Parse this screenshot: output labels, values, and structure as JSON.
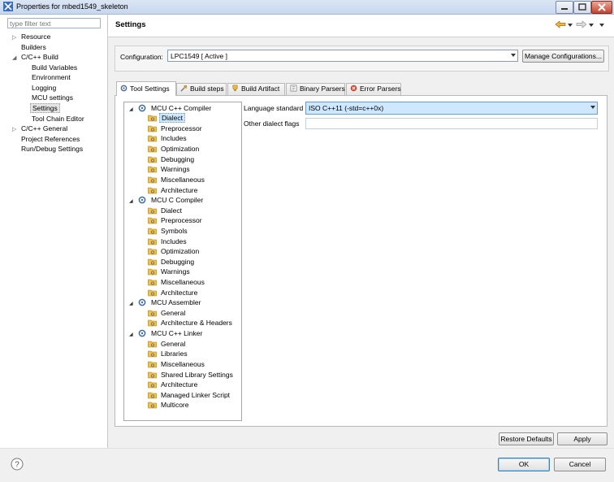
{
  "window": {
    "title": "Properties for mbed1549_skeleton"
  },
  "filter": {
    "placeholder": "type filter text"
  },
  "nav": {
    "items": [
      {
        "label": "Resource",
        "expander": "▷"
      },
      {
        "label": "Builders"
      },
      {
        "label": "C/C++ Build",
        "expander": "◢"
      },
      {
        "label": "Build Variables"
      },
      {
        "label": "Environment"
      },
      {
        "label": "Logging"
      },
      {
        "label": "MCU settings"
      },
      {
        "label": "Settings"
      },
      {
        "label": "Tool Chain Editor"
      },
      {
        "label": "C/C++ General",
        "expander": "▷"
      },
      {
        "label": "Project References"
      },
      {
        "label": "Run/Debug Settings"
      }
    ]
  },
  "page": {
    "title": "Settings"
  },
  "config": {
    "label": "Configuration:",
    "value": "LPC1549  [ Active ]",
    "manage_label": "Manage Configurations..."
  },
  "tabs": [
    {
      "label": "Tool Settings",
      "icon": "tool-settings-icon"
    },
    {
      "label": "Build steps",
      "icon": "build-steps-icon"
    },
    {
      "label": "Build Artifact",
      "icon": "build-artifact-icon"
    },
    {
      "label": "Binary Parsers",
      "icon": "binary-parsers-icon"
    },
    {
      "label": "Error Parsers",
      "icon": "error-parsers-icon"
    }
  ],
  "tree": {
    "groups": [
      {
        "label": "MCU C++ Compiler",
        "children": [
          "Dialect",
          "Preprocessor",
          "Includes",
          "Optimization",
          "Debugging",
          "Warnings",
          "Miscellaneous",
          "Architecture"
        ]
      },
      {
        "label": "MCU C Compiler",
        "children": [
          "Dialect",
          "Preprocessor",
          "Symbols",
          "Includes",
          "Optimization",
          "Debugging",
          "Warnings",
          "Miscellaneous",
          "Architecture"
        ]
      },
      {
        "label": "MCU Assembler",
        "children": [
          "General",
          "Architecture & Headers"
        ]
      },
      {
        "label": "MCU C++ Linker",
        "children": [
          "General",
          "Libraries",
          "Miscellaneous",
          "Shared Library Settings",
          "Architecture",
          "Managed Linker Script",
          "Multicore"
        ]
      }
    ],
    "expander": "◢"
  },
  "fields": {
    "language_standard_label": "Language standard",
    "language_standard_value": "ISO C++11 (-std=c++0x)",
    "other_dialect_label": "Other dialect flags",
    "other_dialect_value": ""
  },
  "buttons": {
    "restore": "Restore Defaults",
    "apply": "Apply",
    "ok": "OK",
    "cancel": "Cancel",
    "help": "?"
  },
  "colors": {
    "selection": "#cde8ff",
    "selection_border": "#6b9bd2",
    "folder": "#f0c24c"
  }
}
